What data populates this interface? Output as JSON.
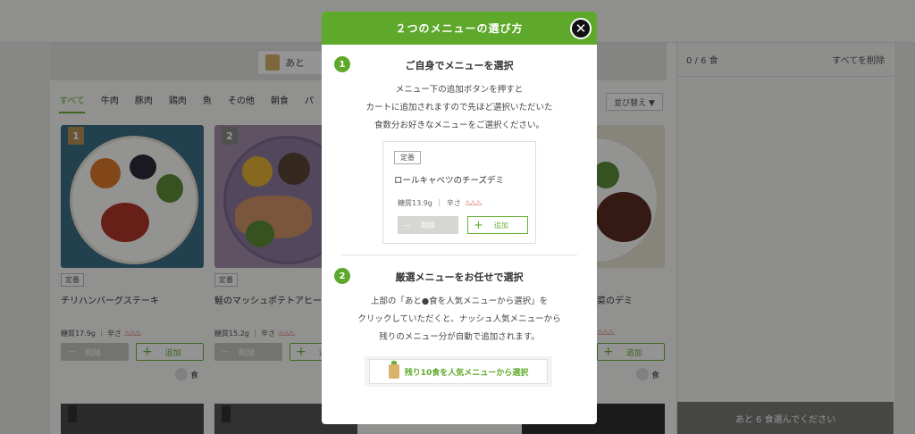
{
  "background": {
    "banner_label": "あと",
    "categories": [
      "すべて",
      "牛肉",
      "豚肉",
      "鶏肉",
      "魚",
      "その他",
      "朝食",
      "パ"
    ],
    "sort_label": "並び替え ▼",
    "cards": [
      {
        "num": "1",
        "tag": "定番",
        "name": "チリハンバーグステーキ",
        "carb": "糖質17.9g",
        "spice": "辛さ",
        "del": "削除",
        "add": "追加",
        "qty": "食"
      },
      {
        "num": "2",
        "tag": "定番",
        "name": "鮭のマッシュポテトアヒー",
        "carb": "糖質15.2g",
        "spice": "辛さ",
        "del": "削除",
        "add": "追加",
        "qty": "食"
      },
      {
        "num": "",
        "tag": "",
        "name": "菜のデミ",
        "carb": "",
        "spice": "",
        "del": "",
        "add": "追加",
        "qty": "食"
      }
    ],
    "lower_nums": [
      "5",
      "6"
    ],
    "cart": {
      "count": "0 / 6 食",
      "clear": "すべてを削除",
      "footer": "あと 6 食選んでください"
    }
  },
  "modal": {
    "title": "２つのメニューの選び方",
    "close": "✕",
    "section1": {
      "step": "1",
      "title": "ご自身でメニューを選択",
      "lines": [
        "メニュー下の追加ボタンを押すと",
        "カートに追加されますので先ほど選択いただいた",
        "食数分お好きなメニューをご選択ください。"
      ]
    },
    "sample_card": {
      "tag": "定番",
      "name": "ロールキャベツのチーズデミ",
      "carb": "糖質13.9g",
      "spice": "辛さ",
      "del_label": "削除",
      "add_label": "追加"
    },
    "section2": {
      "step": "2",
      "title": "厳選メニューをお任せで選択",
      "lines": [
        "上部の「あと●食を人気メニューから選択」を",
        "クリックしていただくと、ナッシュ人気メニューから",
        "残りのメニュー分が自動で追加されます。"
      ]
    },
    "auto_button": "残り10食を人気メニューから選択"
  },
  "colors": {
    "accent": "#5ea92b",
    "overlay": "rgba(0,0,0,0.42)"
  }
}
